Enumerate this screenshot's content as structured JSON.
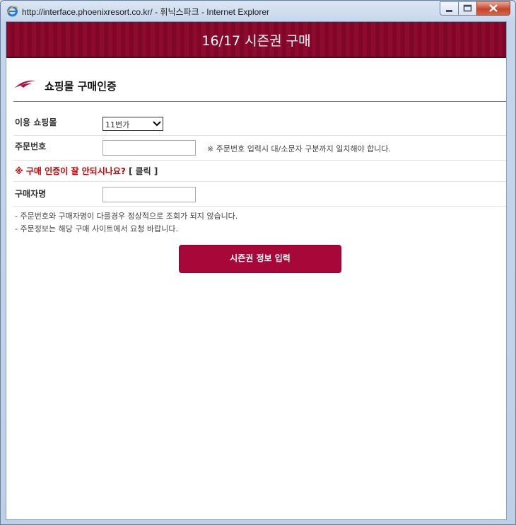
{
  "window": {
    "title": "http://interface.phoenixresort.co.kr/ - 휘닉스파크 - Internet Explorer"
  },
  "header": {
    "title": "16/17 시즌권 구매"
  },
  "section": {
    "title": "쇼핑몰 구매인증"
  },
  "form": {
    "mall_label": "이용 쇼핑몰",
    "mall_selected": "11번가",
    "order_label": "주문번호",
    "order_value": "",
    "order_note": "※ 주문번호 입력시 대/소문자 구분까지 일치해야 합니다.",
    "help_text": "※ 구매 인증이 잘 안되시나요?",
    "help_click": "[ 클릭 ]",
    "buyer_label": "구매자명",
    "buyer_value": ""
  },
  "info": {
    "line1": "- 주문번호와 구매자명이 다를경우 정상적으로 조회가 되지 않습니다.",
    "line2": "- 주문정보는 해당 구매 사이트에서 요청 바랍니다."
  },
  "button": {
    "submit_label": "시즌권 정보 입력"
  },
  "colors": {
    "brand": "#8e0a2e",
    "button": "#a8073a",
    "warning": "#cc0000"
  }
}
